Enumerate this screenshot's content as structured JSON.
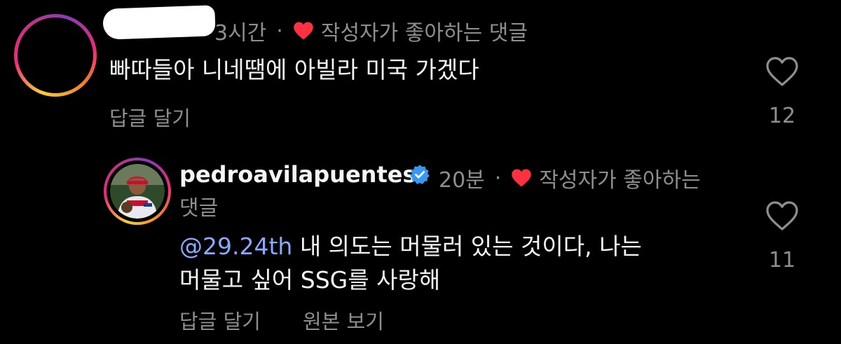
{
  "colors": {
    "background": "#000000",
    "text": "#f5f5f5",
    "muted": "#8e8e8e",
    "mention": "#8aa8ff",
    "heart": "#ff3040",
    "verified": "#3897f0"
  },
  "comment": {
    "time": "3시간",
    "separator": "·",
    "author_liked": "작성자가 좋아하는 댓글",
    "text": "빠따들아 니네땜에 아빌라 미국 가겠다",
    "reply_label": "답글 달기",
    "like_count": "12",
    "icons": [
      "heart-outline-icon",
      "heart-filled-icon"
    ]
  },
  "reply": {
    "username": "pedroavilapuentes",
    "time": "20분",
    "separator": "·",
    "author_liked_line1": "작성자가 좋아하는",
    "author_liked_line2": "댓글",
    "mention": "@29.24th",
    "text_line1": " 내 의도는 머물러 있는 것이다, 나는",
    "text_line2": "머물고 싶어 SSG를 사랑해",
    "reply_label": "답글 달기",
    "view_original_label": "원본 보기",
    "like_count": "11",
    "icons": [
      "verified-badge-icon",
      "heart-filled-icon",
      "heart-outline-icon"
    ]
  }
}
